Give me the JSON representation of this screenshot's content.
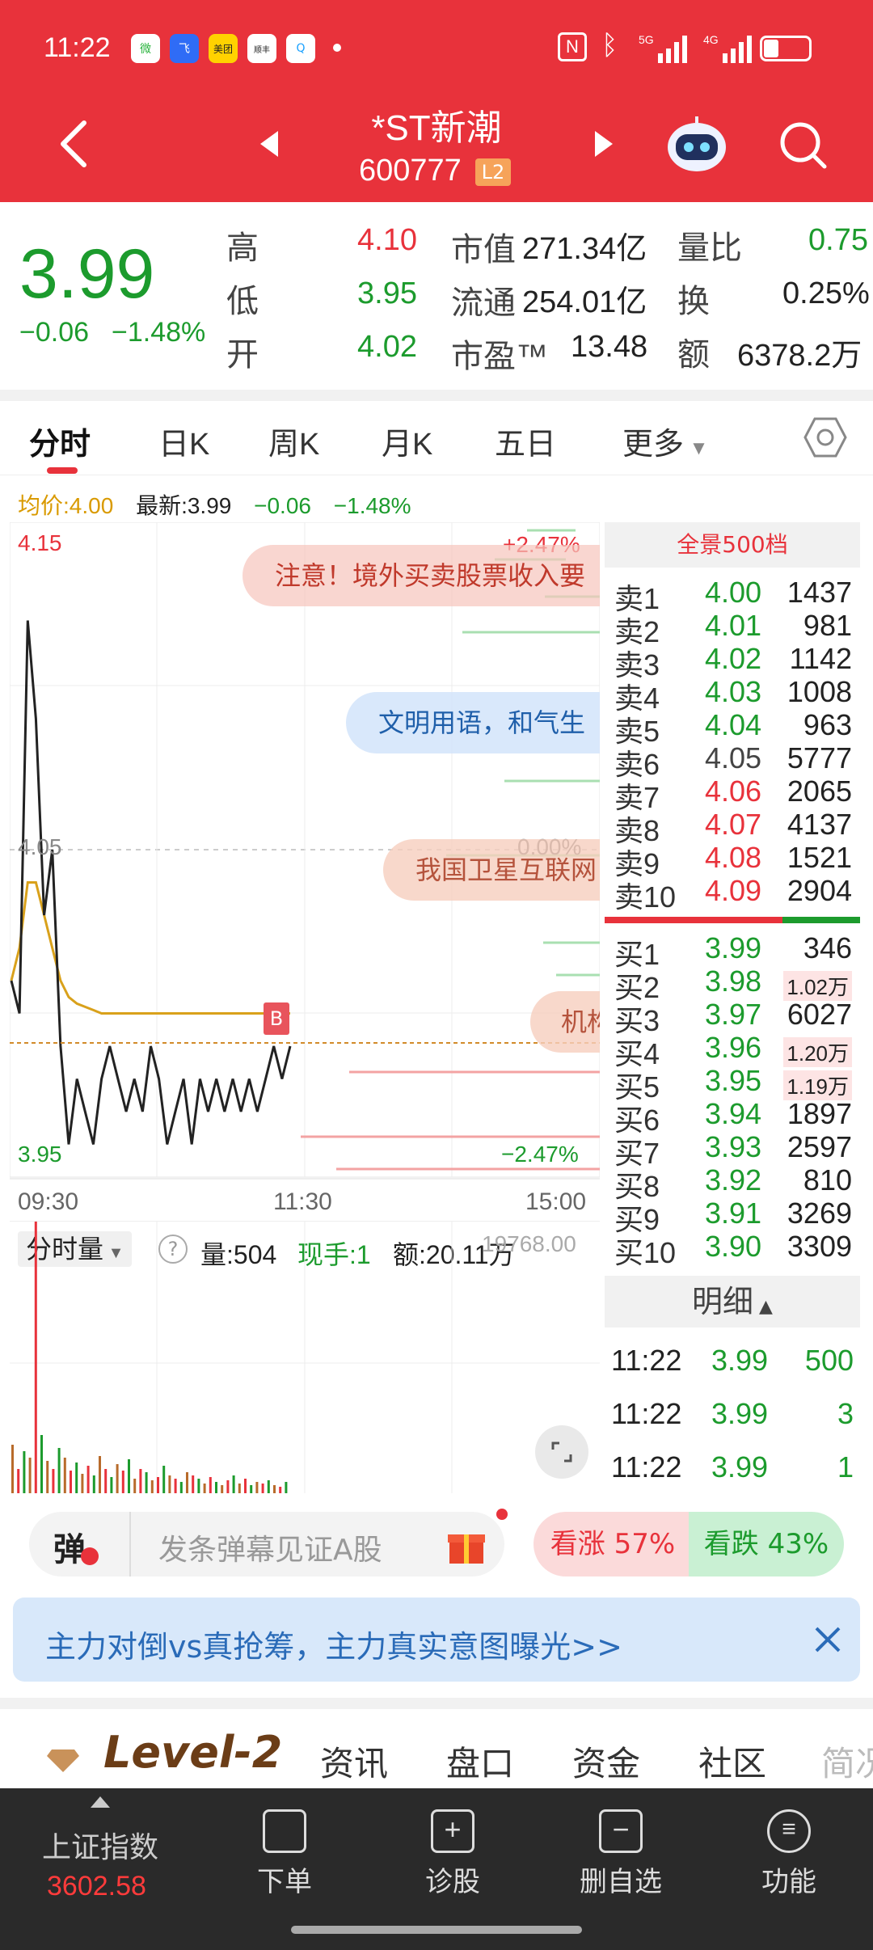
{
  "status": {
    "time": "11:22",
    "apps": [
      "微",
      "飞",
      "美团",
      "顺丰小哥",
      "Q"
    ],
    "net": [
      "5G",
      "4G"
    ]
  },
  "header": {
    "title": "*ST新潮",
    "code": "600777",
    "level_badge": "L2"
  },
  "quote": {
    "price": "3.99",
    "change": "−0.06",
    "change_pct": "−1.48%",
    "high_label": "高",
    "high": "4.10",
    "low_label": "低",
    "low": "3.95",
    "open_label": "开",
    "open": "4.02",
    "mcap_label": "市值",
    "mcap": "271.34亿",
    "float_label": "流通",
    "float": "254.01亿",
    "pe_label": "市盈™",
    "pe": "13.48",
    "vr_label": "量比",
    "vr": "0.75",
    "turn_label": "换",
    "turn": "0.25%",
    "amt_label": "额",
    "amt": "6378.2万"
  },
  "tabs": [
    "分时",
    "日K",
    "周K",
    "月K",
    "五日",
    "更多"
  ],
  "info_line": {
    "avg": "均价:4.00",
    "latest": "最新:3.99",
    "chg": "−0.06",
    "pct": "−1.48%"
  },
  "chart": {
    "y_top": "4.15",
    "y_mid": "4.05",
    "y_bot": "3.95",
    "pct_top": "+2.47%",
    "pct_mid": "0.00%",
    "pct_bot": "−2.47%",
    "x_labels": [
      "09:30",
      "11:30",
      "15:00"
    ],
    "marker": "B",
    "danmaku": [
      "注意！境外买卖股票收入要",
      "文明用语，和气生",
      "我国卫星互联网",
      "机构"
    ]
  },
  "chart_data": {
    "type": "line",
    "series": [
      {
        "values": [
          4.01,
          4.0,
          4.12,
          4.09,
          4.03,
          4.05,
          3.99,
          3.96,
          3.98,
          3.97,
          3.96,
          3.98,
          3.99,
          3.98,
          3.97,
          3.98,
          3.97,
          3.99,
          3.98,
          3.96,
          3.97,
          3.98,
          3.96,
          3.98,
          3.97,
          3.98,
          3.97,
          3.98,
          3.97,
          3.98,
          3.97,
          3.98,
          3.99,
          3.98,
          3.99
        ]
      },
      {
        "values": [
          4.01,
          4.02,
          4.04,
          4.04,
          4.03,
          4.02,
          4.01,
          4.005,
          4.003,
          4.002,
          4.001,
          4.0,
          4.0,
          4.0,
          4.0,
          4.0,
          4.0,
          4.0,
          4.0,
          4.0,
          4.0,
          4.0,
          4.0,
          4.0,
          4.0,
          4.0,
          4.0,
          4.0,
          4.0,
          4.0,
          4.0,
          4.0,
          4.0,
          4.0,
          4.0
        ]
      }
    ],
    "ylim": [
      3.95,
      4.15
    ]
  },
  "vol_bar": {
    "label": "分时量",
    "vol": "量:504",
    "now": "现手:1",
    "amt": "额:20.11万",
    "max": "19768.00"
  },
  "orderbook": {
    "title": "全景500档",
    "asks": [
      {
        "label": "卖10",
        "price": "4.09",
        "qty": "2904"
      },
      {
        "label": "卖9",
        "price": "4.08",
        "qty": "1521"
      },
      {
        "label": "卖8",
        "price": "4.07",
        "qty": "4137"
      },
      {
        "label": "卖7",
        "price": "4.06",
        "qty": "2065"
      },
      {
        "label": "卖6",
        "price": "4.05",
        "qty": "5777"
      },
      {
        "label": "卖5",
        "price": "4.04",
        "qty": "963"
      },
      {
        "label": "卖4",
        "price": "4.03",
        "qty": "1008"
      },
      {
        "label": "卖3",
        "price": "4.02",
        "qty": "1142"
      },
      {
        "label": "卖2",
        "price": "4.01",
        "qty": "981"
      },
      {
        "label": "卖1",
        "price": "4.00",
        "qty": "1437"
      }
    ],
    "bids": [
      {
        "label": "买1",
        "price": "3.99",
        "qty": "346"
      },
      {
        "label": "买2",
        "price": "3.98",
        "qty": "1.02万"
      },
      {
        "label": "买3",
        "price": "3.97",
        "qty": "6027"
      },
      {
        "label": "买4",
        "price": "3.96",
        "qty": "1.20万"
      },
      {
        "label": "买5",
        "price": "3.95",
        "qty": "1.19万"
      },
      {
        "label": "买6",
        "price": "3.94",
        "qty": "1897"
      },
      {
        "label": "买7",
        "price": "3.93",
        "qty": "2597"
      },
      {
        "label": "买8",
        "price": "3.92",
        "qty": "810"
      },
      {
        "label": "买9",
        "price": "3.91",
        "qty": "3269"
      },
      {
        "label": "买10",
        "price": "3.90",
        "qty": "3309"
      }
    ],
    "detail_title": "明细",
    "details": [
      {
        "time": "11:22",
        "price": "3.99",
        "qty": "500"
      },
      {
        "time": "11:22",
        "price": "3.99",
        "qty": "3"
      },
      {
        "time": "11:22",
        "price": "3.99",
        "qty": "1"
      }
    ]
  },
  "danmu": {
    "tag": "弹",
    "placeholder": "发条弹幕见证A股",
    "up": "看涨 57%",
    "down": "看跌 43%"
  },
  "banner": {
    "text": "主力对倒vs真抢筹，主力真实意图曝光>>"
  },
  "subtabs": {
    "level2": "Level-2",
    "items": [
      "资讯",
      "盘口",
      "资金",
      "社区",
      "简况"
    ]
  },
  "nav": {
    "index_name": "上证指数",
    "index_val": "3602.58",
    "items": [
      "下单",
      "诊股",
      "删自选",
      "功能"
    ]
  }
}
